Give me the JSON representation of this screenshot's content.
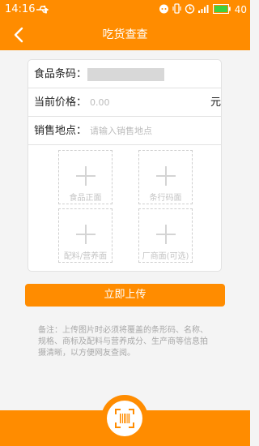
{
  "status_bar": {
    "time": "14:16",
    "battery_level": "40",
    "icons": [
      "usb-icon",
      "cat-icon",
      "vibrate-icon",
      "alarm-icon",
      "signal-4g-icon",
      "battery-icon"
    ]
  },
  "header": {
    "title": "吃货查查",
    "back_icon": "back-chevron-icon"
  },
  "form": {
    "barcode_label": "食品条码：",
    "price_label": "当前价格：",
    "price_placeholder": "0.00",
    "price_unit": "元",
    "location_label": "销售地点：",
    "location_placeholder": "请输入销售地点"
  },
  "uploads": [
    {
      "label": "食品正面"
    },
    {
      "label": "条行码面"
    },
    {
      "label": "配料/营养面"
    },
    {
      "label": "厂商面(可选)"
    }
  ],
  "submit_label": "立即上传",
  "note": "备注：上传图片时必须将覆盖的条形码、名称、规格、商标及配料与营养成分、生产商等信息拍摄清晰，以方便网友查阅。",
  "colors": {
    "accent": "#ff8c00",
    "background": "#f4f4f4"
  },
  "scan_icon": "barcode-scan-icon"
}
